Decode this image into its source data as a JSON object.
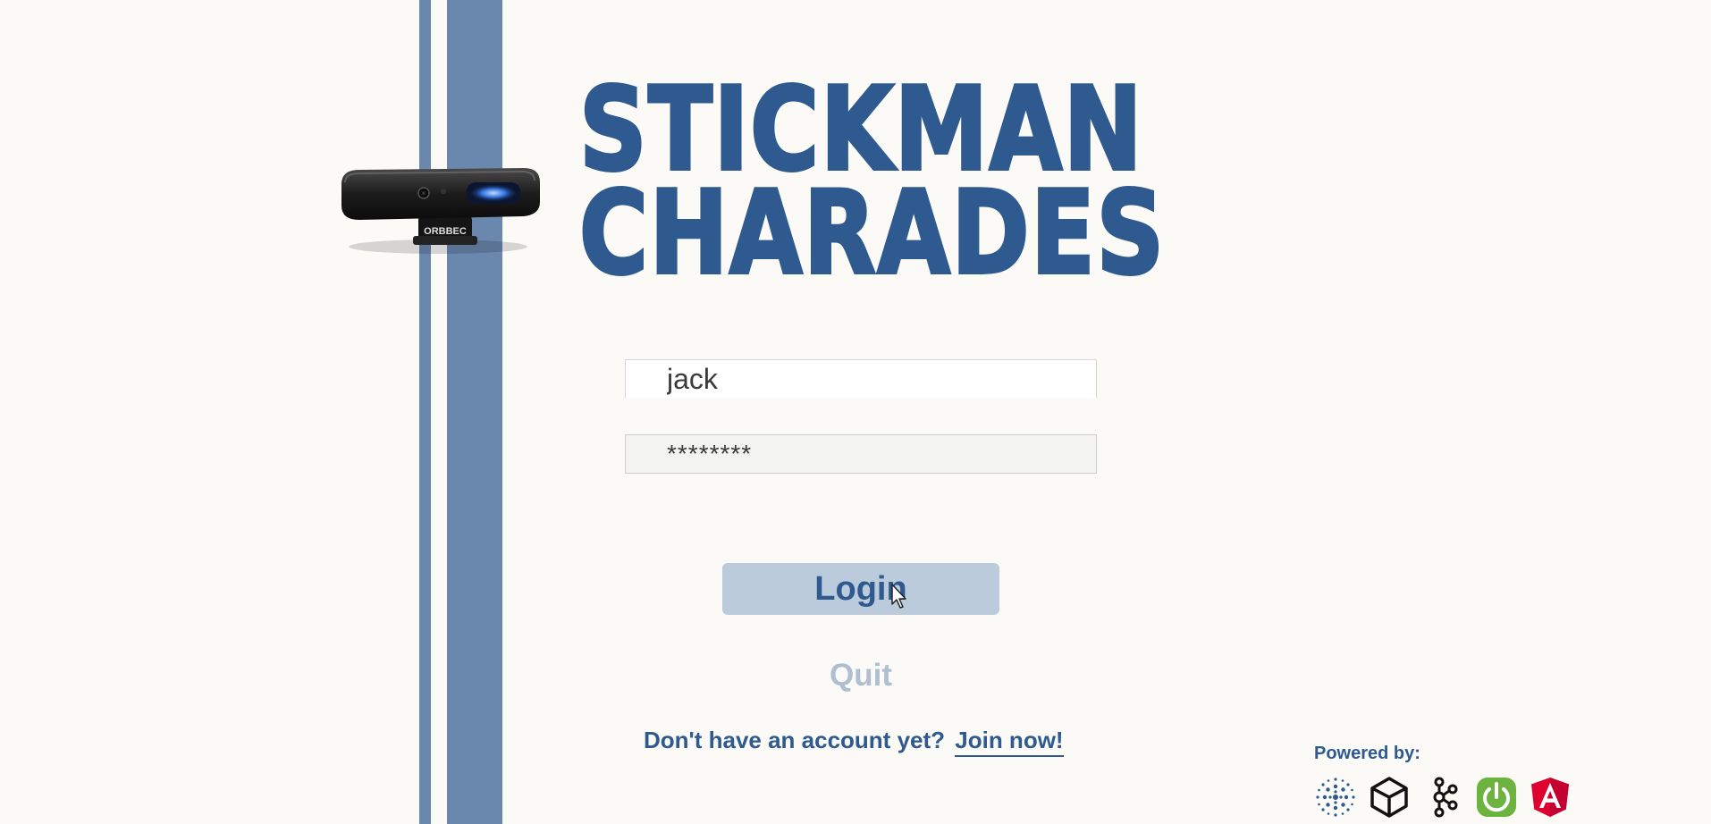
{
  "title": {
    "line1": "STICKMAN",
    "line2": "CHARADES"
  },
  "login_form": {
    "username_value": "jack",
    "password_display": "********",
    "login_label": "Login",
    "quit_label": "Quit"
  },
  "signup": {
    "prompt": "Don't have an account yet?",
    "link_label": "Join now!"
  },
  "footer": {
    "powered_by": "Powered by:",
    "logos": [
      "dot-sphere-icon",
      "unity-icon",
      "kafka-icon",
      "spring-power-icon",
      "angular-icon"
    ]
  },
  "colors": {
    "brand_blue": "#2e5a8f",
    "stripe_blue": "#6a87ad",
    "login_button_bg": "#bccbdb",
    "quit_text": "#aebfd2",
    "spring_green": "#6db33f",
    "angular_red": "#dd0031"
  }
}
